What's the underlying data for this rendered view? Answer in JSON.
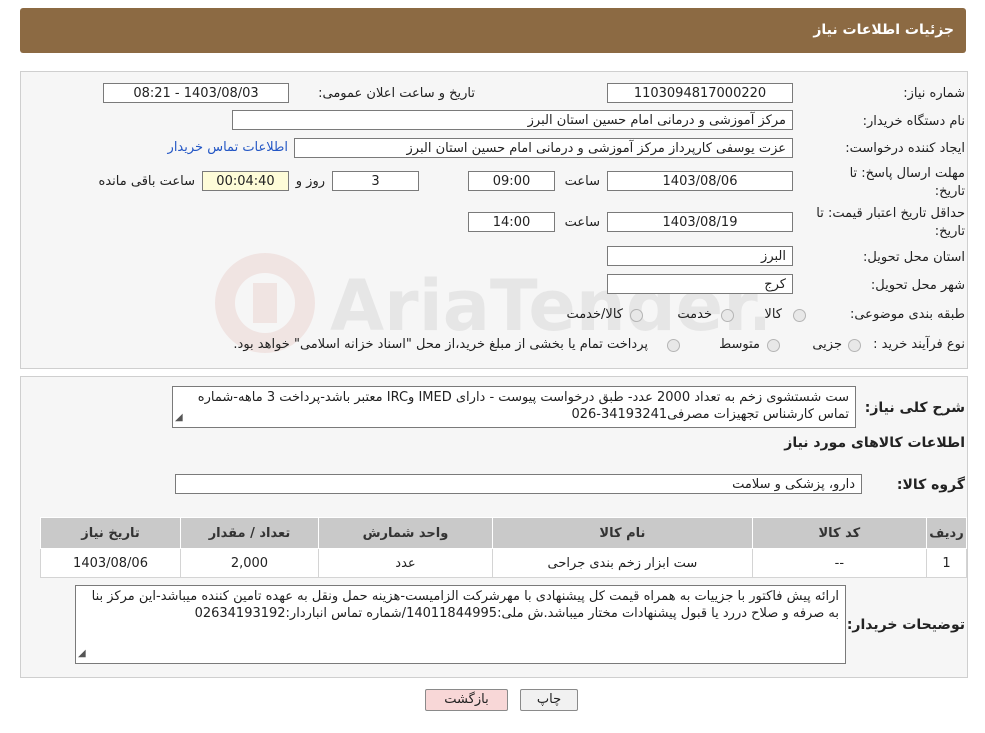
{
  "header": {
    "title": "جزئیات اطلاعات نیاز"
  },
  "form": {
    "need_number_label": "شماره نیاز:",
    "need_number": "1103094817000220",
    "announce_label": "تاریخ و ساعت اعلان عمومی:",
    "announce_value": "1403/08/03 - 08:21",
    "buyer_org_label": "نام دستگاه خریدار:",
    "buyer_org": "مرکز آموزشی و درمانی امام حسین استان البرز",
    "creator_label": "ایجاد کننده درخواست:",
    "creator": "عزت یوسفی کارپرداز مرکز آموزشی و درمانی امام حسین استان البرز",
    "contact_link": "اطلاعات تماس خریدار",
    "deadline_label_1": "مهلت ارسال پاسخ: تا",
    "deadline_label_2": "تاریخ:",
    "deadline_date": "1403/08/06",
    "time_label": "ساعت",
    "deadline_time": "09:00",
    "days": "3",
    "days_label": "روز و",
    "remaining": "00:04:40",
    "remaining_label": "ساعت باقی مانده",
    "validity_label_1": "حداقل تاریخ اعتبار قیمت: تا",
    "validity_label_2": "تاریخ:",
    "validity_date": "1403/08/19",
    "validity_time": "14:00",
    "province_label": "استان محل تحویل:",
    "province": "البرز",
    "city_label": "شهر محل تحویل:",
    "city": "کرج",
    "category_label": "طبقه بندی موضوعی:",
    "category_options": [
      "کالا",
      "خدمت",
      "کالا/خدمت"
    ],
    "process_label": "نوع فرآیند خرید :",
    "process_options": [
      "جزیی",
      "متوسط"
    ],
    "process_note": "پرداخت تمام یا بخشی از مبلغ خرید،از محل \"اسناد خزانه اسلامی\" خواهد بود."
  },
  "description": {
    "label": "شرح کلی نیاز:",
    "text": "ست شستشوی زخم به تعداد 2000 عدد- طبق درخواست پیوست - دارای IMED وIRC  معتبر باشد-پرداخت 3 ماهه-شماره تماس کارشناس تجهیزات مصرفی34193241-026"
  },
  "goods": {
    "section_title": "اطلاعات کالاهای مورد نیاز",
    "group_label": "گروه کالا:",
    "group_value": "دارو، پزشکی و سلامت",
    "columns": [
      "ردیف",
      "کد کالا",
      "نام کالا",
      "واحد شمارش",
      "تعداد / مقدار",
      "تاریخ نیاز"
    ],
    "rows": [
      [
        "1",
        "--",
        "ست ابزار زخم بندی جراحی",
        "عدد",
        "2,000",
        "1403/08/06"
      ]
    ]
  },
  "buyer_notes": {
    "label": "توضیحات خریدار:",
    "text": "ارائه پیش فاکتور با جزییات به همراه قیمت کل پیشنهادی با مهرشرکت الزامیست-هزینه حمل ونقل به عهده تامین کننده میباشد-این مرکز بنا به صرفه و صلاح دررد یا قبول پیشنهادات مختار میباشد.ش ملی:14011844995/شماره تماس انباردار:02634193192"
  },
  "buttons": {
    "print": "چاپ",
    "back": "بازگشت"
  },
  "watermark": {
    "brand": "AriaTender.neT"
  },
  "colors": {
    "header_bg": "#8c6a43",
    "link": "#2457c5",
    "remaining_bg": "#fefcd8",
    "back_btn_bg": "#f8d7d7"
  }
}
